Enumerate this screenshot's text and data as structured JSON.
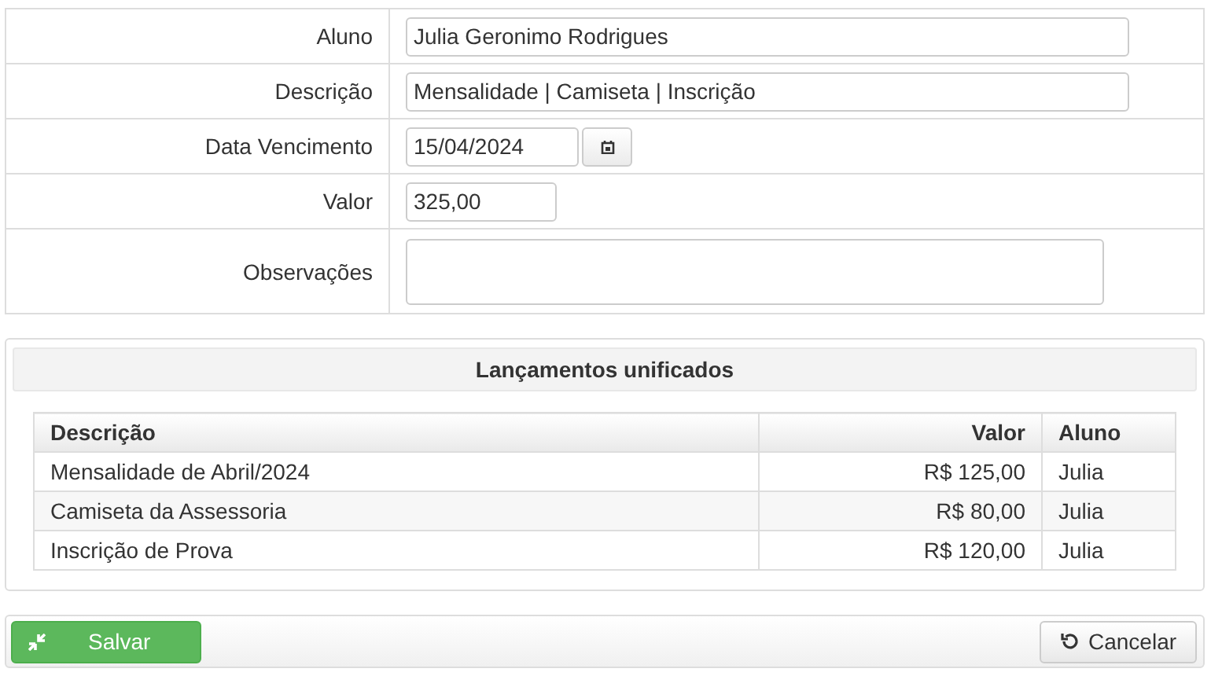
{
  "form": {
    "fields": [
      {
        "label": "Aluno",
        "kind": "text",
        "value": "Julia Geronimo Rodrigues"
      },
      {
        "label": "Descrição",
        "kind": "text",
        "value": "Mensalidade | Camiseta | Inscrição"
      },
      {
        "label": "Data Vencimento",
        "kind": "date",
        "value": "15/04/2024"
      },
      {
        "label": "Valor",
        "kind": "amount",
        "value": "325,00"
      },
      {
        "label": "Observações",
        "kind": "textarea"
      }
    ]
  },
  "panel": {
    "title": "Lançamentos unificados",
    "table": {
      "columns": [
        "Descrição",
        "Valor",
        "Aluno"
      ],
      "rows": [
        [
          "Mensalidade de Abril/2024",
          "R$ 125,00",
          "Julia"
        ],
        [
          "Camiseta da Assessoria",
          "R$ 80,00",
          "Julia"
        ],
        [
          "Inscrição de Prova",
          "R$ 120,00",
          "Julia"
        ]
      ]
    }
  },
  "buttons": {
    "save": "Salvar",
    "cancel": "Cancelar"
  }
}
